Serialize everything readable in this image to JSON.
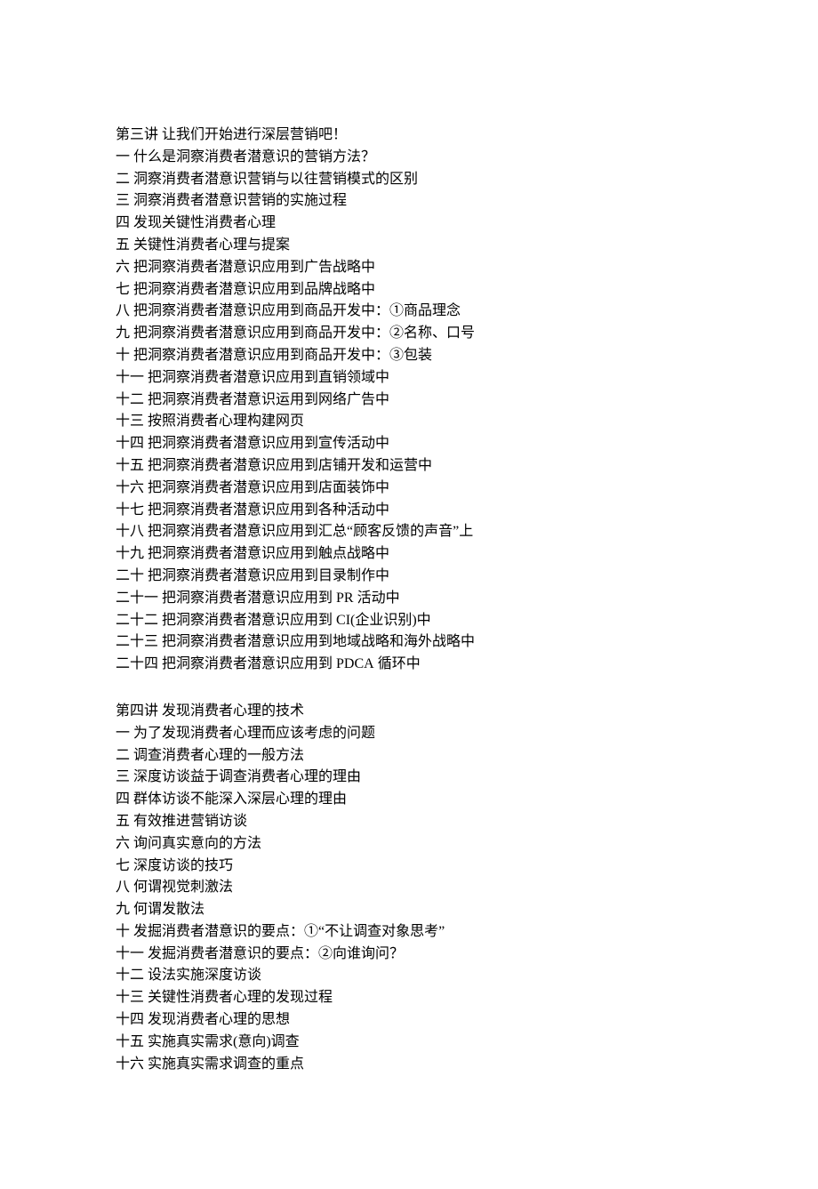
{
  "sections": [
    {
      "heading": "第三讲 让我们开始进行深层营销吧！",
      "items": [
        "一 什么是洞察消费者潜意识的营销方法？",
        "二 洞察消费者潜意识营销与以往营销模式的区别",
        "三 洞察消费者潜意识营销的实施过程",
        "四 发现关键性消费者心理",
        "五 关键性消费者心理与提案",
        "六 把洞察消费者潜意识应用到广告战略中",
        "七 把洞察消费者潜意识应用到品牌战略中",
        "八 把洞察消费者潜意识应用到商品开发中：①商品理念",
        "九 把洞察消费者潜意识应用到商品开发中：②名称、口号",
        "十 把洞察消费者潜意识应用到商品开发中：③包装",
        "十一 把洞察消费者潜意识应用到直销领域中",
        "十二 把洞察消费者潜意识运用到网络广告中",
        "十三 按照消费者心理构建网页",
        "十四 把洞察消费者潜意识应用到宣传活动中",
        "十五 把洞察消费者潜意识应用到店铺开发和运营中",
        "十六 把洞察消费者潜意识应用到店面装饰中",
        "十七 把洞察消费者潜意识应用到各种活动中",
        "十八 把洞察消费者潜意识应用到汇总“顾客反馈的声音”上",
        "十九 把洞察消费者潜意识应用到触点战略中",
        "二十 把洞察消费者潜意识应用到目录制作中",
        "二十一 把洞察消费者潜意识应用到 PR 活动中",
        "二十二 把洞察消费者潜意识应用到 CI(企业识别)中",
        "二十三 把洞察消费者潜意识应用到地域战略和海外战略中",
        "二十四 把洞察消费者潜意识应用到 PDCA 循环中"
      ]
    },
    {
      "heading": "第四讲 发现消费者心理的技术",
      "items": [
        "一 为了发现消费者心理而应该考虑的问题",
        "二 调查消费者心理的一般方法",
        "三 深度访谈益于调查消费者心理的理由",
        "四 群体访谈不能深入深层心理的理由",
        "五 有效推进营销访谈",
        "六 询问真实意向的方法",
        "七 深度访谈的技巧",
        "八 何谓视觉刺激法",
        "九 何谓发散法",
        "十 发掘消费者潜意识的要点：①“不让调查对象思考”",
        "十一 发掘消费者潜意识的要点：②向谁询问？",
        "十二 设法实施深度访谈",
        "十三 关键性消费者心理的发现过程",
        "十四 发现消费者心理的思想",
        "十五 实施真实需求(意向)调查",
        "十六 实施真实需求调查的重点"
      ]
    }
  ]
}
